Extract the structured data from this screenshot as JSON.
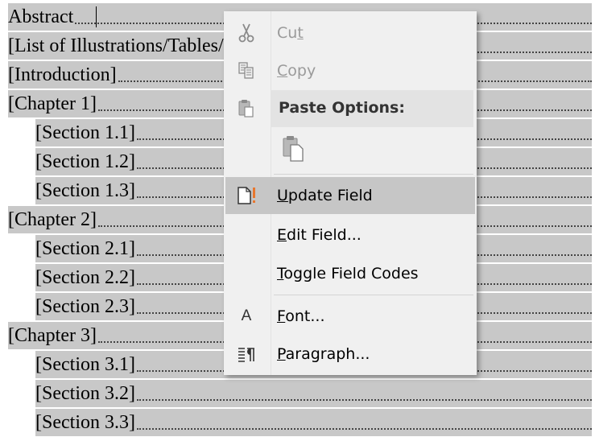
{
  "document": {
    "toc": [
      {
        "text": "Abstract",
        "indent": 0
      },
      {
        "text": "[List of Illustrations/Tables/Images]",
        "indent": 0
      },
      {
        "text": "[Introduction]",
        "indent": 0
      },
      {
        "text": "[Chapter 1]",
        "indent": 0
      },
      {
        "text": "[Section 1.1]",
        "indent": 1
      },
      {
        "text": "[Section 1.2]",
        "indent": 1
      },
      {
        "text": "[Section 1.3]",
        "indent": 1
      },
      {
        "text": "[Chapter 2]",
        "indent": 0
      },
      {
        "text": "[Section 2.1]",
        "indent": 1
      },
      {
        "text": "[Section 2.2]",
        "indent": 1
      },
      {
        "text": "[Section 2.3]",
        "indent": 1
      },
      {
        "text": "[Chapter 3]",
        "indent": 0
      },
      {
        "text": "[Section 3.1]",
        "indent": 1
      },
      {
        "text": "[Section 3.2]",
        "indent": 1
      },
      {
        "text": "[Section 3.3]",
        "indent": 1
      }
    ],
    "field_shading": "#c8c8c8"
  },
  "context_menu": {
    "cut": {
      "label_pre": "Cu",
      "accel": "t",
      "label_post": "",
      "icon": "scissors-icon",
      "enabled": false
    },
    "copy": {
      "label_pre": "",
      "accel": "C",
      "label_post": "opy",
      "icon": "copy-icon",
      "enabled": false
    },
    "paste_options": {
      "label": "Paste Options:",
      "icon": "clipboard-icon"
    },
    "paste_keep_text": {
      "icon": "paste-keep-text-icon"
    },
    "update_field": {
      "label_pre": "",
      "accel": "U",
      "label_post": "pdate Field",
      "icon": "update-field-icon",
      "highlighted": true
    },
    "edit_field": {
      "label_pre": "",
      "accel": "E",
      "label_post": "dit Field...",
      "icon": ""
    },
    "toggle_field_codes": {
      "label_pre": "",
      "accel": "T",
      "label_post": "oggle Field Codes",
      "icon": ""
    },
    "font": {
      "label_pre": "",
      "accel": "F",
      "label_post": "ont...",
      "icon": "font-icon",
      "icon_text": "A"
    },
    "paragraph": {
      "label_pre": "",
      "accel": "P",
      "label_post": "aragraph...",
      "icon": "paragraph-icon"
    }
  },
  "colors": {
    "menu_bg": "#f0f0f0",
    "menu_highlight": "#c6c6c6",
    "disabled_text": "#9a9a9a",
    "update_icon_accent": "#e8772e"
  }
}
